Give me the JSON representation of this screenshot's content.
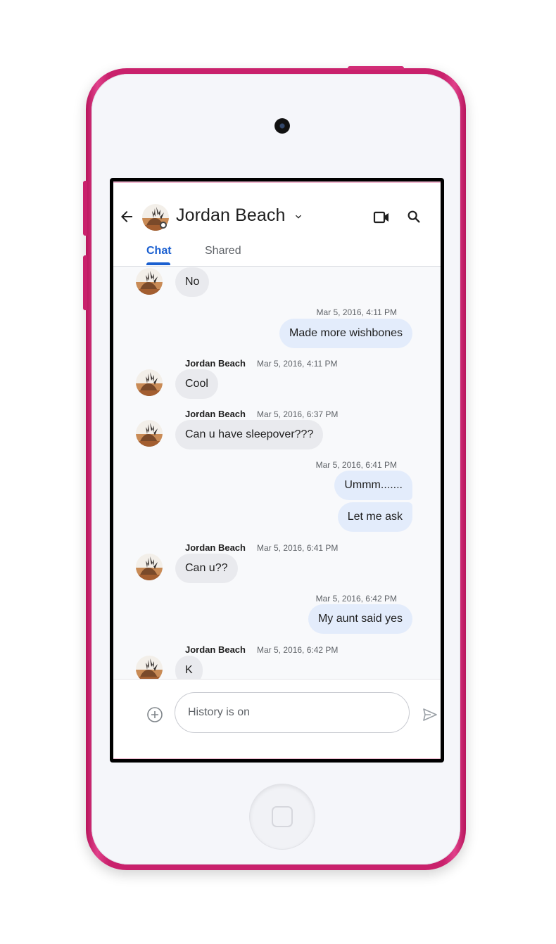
{
  "colors": {
    "device": "#c9216c",
    "accent": "#1a5fd0",
    "incoming_bubble": "#e9eaee",
    "outgoing_bubble": "#e3ecfb"
  },
  "header": {
    "contact_name": "Jordan Beach",
    "icons": [
      "back-arrow-icon",
      "chevron-down-icon",
      "video-call-icon",
      "search-icon"
    ]
  },
  "tabs": [
    {
      "label": "Chat",
      "active": true
    },
    {
      "label": "Shared",
      "active": false
    }
  ],
  "messages": [
    {
      "direction": "in",
      "text": "No"
    },
    {
      "direction": "out",
      "time": "Mar 5, 2016, 4:11 PM",
      "text": "Made more wishbones"
    },
    {
      "direction": "in",
      "sender": "Jordan Beach",
      "time": "Mar 5, 2016, 4:11 PM",
      "text": "Cool"
    },
    {
      "direction": "in",
      "sender": "Jordan Beach",
      "time": "Mar 5, 2016, 6:37 PM",
      "text": "Can u have sleepover???"
    },
    {
      "direction": "out",
      "time": "Mar 5, 2016, 6:41 PM",
      "text": "Ummm......."
    },
    {
      "direction": "out",
      "text": "Let me ask"
    },
    {
      "direction": "in",
      "sender": "Jordan Beach",
      "time": "Mar 5, 2016, 6:41 PM",
      "text": "Can u??"
    },
    {
      "direction": "out",
      "time": "Mar 5, 2016, 6:42 PM",
      "text": "My aunt said yes"
    },
    {
      "direction": "in",
      "sender": "Jordan Beach",
      "time": "Mar 5, 2016, 6:42 PM",
      "text": "K"
    }
  ],
  "composer": {
    "placeholder": "History is on",
    "value": ""
  }
}
